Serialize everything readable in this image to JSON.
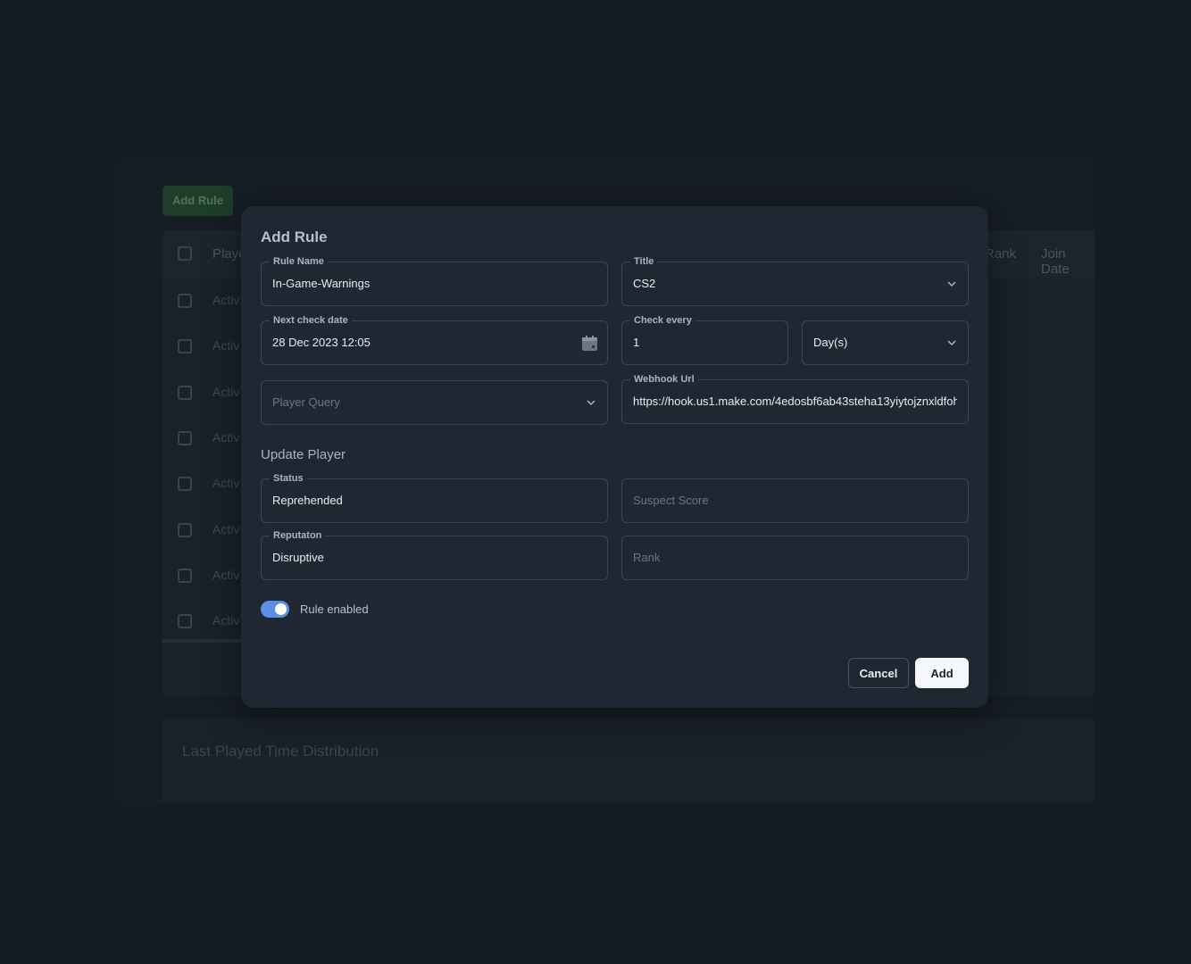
{
  "background": {
    "add_rule_label": "Add Rule",
    "table_headers": [
      "Playe",
      "Rank",
      "Join Date"
    ],
    "row_status": "Activ",
    "row_count": 8,
    "chart_title": "Last Played Time Distribution"
  },
  "modal": {
    "title": "Add Rule",
    "rule_name": {
      "label": "Rule Name",
      "value": "In-Game-Warnings"
    },
    "title_field": {
      "label": "Title",
      "value": "CS2"
    },
    "next_check_date": {
      "label": "Next check date",
      "value": "28 Dec 2023 12:05"
    },
    "check_every": {
      "label": "Check every",
      "value": "1"
    },
    "check_unit": {
      "value": "Day(s)"
    },
    "player_query": {
      "placeholder": "Player Query"
    },
    "webhook_url": {
      "label": "Webhook Url",
      "value": "https://hook.us1.make.com/4edosbf6ab43steha13yiytojznxldfoh"
    },
    "update_section_title": "Update Player",
    "status": {
      "label": "Status",
      "value": "Reprehended"
    },
    "suspect_score": {
      "placeholder": "Suspect Score"
    },
    "reputation": {
      "label": "Reputaton",
      "value": "Disruptive"
    },
    "rank": {
      "placeholder": "Rank"
    },
    "rule_enabled_label": "Rule enabled",
    "rule_enabled": true,
    "cancel_label": "Cancel",
    "add_label": "Add"
  },
  "colors": {
    "accent": "#5b8ee6",
    "modal_bg": "#1f2832",
    "page_bg": "#151b22"
  }
}
